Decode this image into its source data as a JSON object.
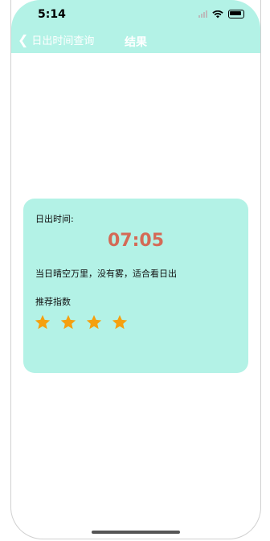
{
  "status_bar": {
    "time": "5:14"
  },
  "nav": {
    "back_label": "日出时间查询",
    "title": "结果"
  },
  "result": {
    "sunrise_label": "日出时间:",
    "sunrise_time": "07:05",
    "weather_description": "当日晴空万里，没有雾，适合看日出",
    "recommend_label": "推荐指数",
    "rating": 4,
    "star_color": "#f5a00f"
  },
  "colors": {
    "accent": "#b3f2e6",
    "time_color": "#d46a56"
  }
}
